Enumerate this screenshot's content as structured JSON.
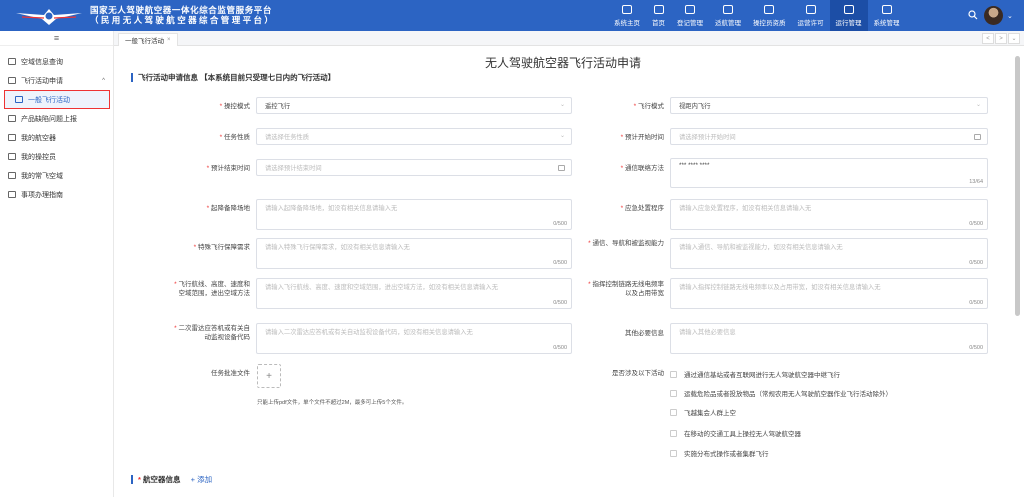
{
  "header": {
    "title_line1": "国家无人驾驶航空器一体化综合监管服务平台",
    "title_line2": "（民用无人驾驶航空器综合管理平台）",
    "nav": [
      {
        "label": "系统主页"
      },
      {
        "label": "首页"
      },
      {
        "label": "登记管理"
      },
      {
        "label": "适航管理"
      },
      {
        "label": "操控员资质"
      },
      {
        "label": "运营许可"
      },
      {
        "label": "运行管理"
      },
      {
        "label": "系统管理"
      }
    ],
    "active_nav": "运行管理",
    "caret": "⌄"
  },
  "sidebar": {
    "collapse_icon": "≡",
    "items": [
      {
        "label": "空域信息查询"
      },
      {
        "label": "飞行活动申请",
        "caret": "^"
      },
      {
        "label": "一般飞行活动"
      },
      {
        "label": "产品缺陷问题上报"
      },
      {
        "label": "我的航空器"
      },
      {
        "label": "我的操控员"
      },
      {
        "label": "我的常飞空域"
      },
      {
        "label": "事项办理指南"
      }
    ]
  },
  "tabs": {
    "active": "一般飞行活动",
    "close": "×",
    "ctrl_prev": "<",
    "ctrl_next": ">",
    "ctrl_more": "⌄"
  },
  "page": {
    "title": "无人驾驶航空器飞行活动申请",
    "section1": "飞行活动申请信息 【本系统目前只受理七日内的飞行活动】",
    "section2_star": "*",
    "section2": "航空器信息",
    "section2_add": "+ 添加"
  },
  "form": {
    "control_mode": {
      "label": "操控模式",
      "value": "遥控飞行"
    },
    "flight_mode": {
      "label": "飞行模式",
      "value": "视距内飞行"
    },
    "task_nature": {
      "label": "任务性质",
      "placeholder": "请选择任务性质"
    },
    "start_time": {
      "label": "预计开始时间",
      "placeholder": "请选择预计开始时间"
    },
    "end_time": {
      "label": "预计结束时间",
      "placeholder": "请选择预计结束时间"
    },
    "contact": {
      "label": "通信联络方法",
      "value": "*** **** ****",
      "count": "13/64"
    },
    "takeoff_site": {
      "label": "起降备降场地",
      "placeholder": "请输入起降备降场地，如没有相关信息请输入无",
      "count": "0/500"
    },
    "emergency": {
      "label": "应急处置程序",
      "placeholder": "请输入应急处置程序，如没有相关信息请输入无",
      "count": "0/500"
    },
    "special_needs": {
      "label": "特殊飞行保障需求",
      "placeholder": "请输入特殊飞行保障需求，如没有相关信息请输入无",
      "count": "0/500"
    },
    "comm_nav": {
      "label": "通信、导航和被监视能力",
      "placeholder": "请输入通信、导航和被监视能力，如没有相关信息请输入无",
      "count": "0/500"
    },
    "route": {
      "label": "飞行航线、高度、速度和空域范围，进出空域方法",
      "placeholder": "请输入飞行航线、高度、速度和空域范围，进出空域方法，如没有相关信息请输入无",
      "count": "0/500"
    },
    "radio_link": {
      "label": "指挥控制链路无线电频率以及占用带宽",
      "placeholder": "请输入指挥控制链路无线电频率以及占用带宽，如没有相关信息请输入无",
      "count": "0/500"
    },
    "radar_code": {
      "label": "二次雷达应答机或有关自动监视设备代码",
      "placeholder": "请输入二次雷达应答机或有关自动监视设备代码，如没有相关信息请输入无",
      "count": "0/500"
    },
    "other_info": {
      "label": "其他必要信息",
      "placeholder": "请输入其他必要信息",
      "count": "0/500"
    },
    "task_file": {
      "label": "任务批准文件",
      "plus": "+",
      "hint": "只能上传pdf文件，单个文件不超过2M，最多可上传5个文件。"
    },
    "activities": {
      "label": "是否涉及以下活动",
      "options": [
        "通过通信基站或者互联网进行无人驾驶航空器中继飞行",
        "运载危险品或者投放物品（常规农用无人驾驶航空器作业飞行活动除外）",
        "飞越集会人群上空",
        "在移动的交通工具上操控无人驾驶航空器",
        "实施分布式操作或者集群飞行"
      ]
    }
  }
}
